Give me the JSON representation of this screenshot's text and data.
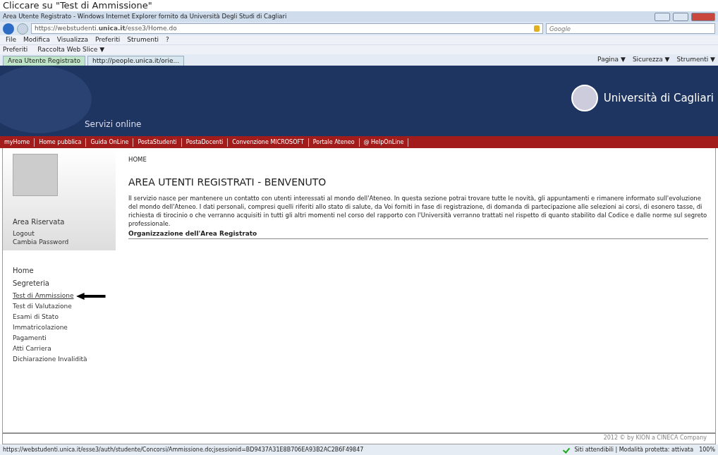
{
  "caption": "Cliccare su \"Test di Ammissione\"",
  "window": {
    "title": "Area Utente Registrato - Windows Internet Explorer fornito da Università Degli Studi di Cagliari"
  },
  "address": {
    "url": "https://webstudenti.**unica.it**/esse3/Home.do",
    "search_placeholder": "Google"
  },
  "menu": [
    "File",
    "Modifica",
    "Visualizza",
    "Preferiti",
    "Strumenti",
    "?"
  ],
  "favorites": [
    "Preferiti",
    "Raccolta Web Slice ▼"
  ],
  "tabs": [
    {
      "label": "Area Utente Registrato",
      "selected": true
    },
    {
      "label": "http://people.unica.it/orie...",
      "selected": false
    }
  ],
  "commands": [
    "Pagina ▼",
    "Sicurezza ▼",
    "Strumenti ▼"
  ],
  "site": {
    "service": "Servizi online",
    "university": "Università di Cagliari",
    "nav": [
      "myHome",
      "Home pubblica",
      "Guida OnLine",
      "PostaStudenti",
      "PostaDocenti",
      "Convenzione MICROSOFT",
      "Portale Ateneo",
      "@ HelpOnLine"
    ],
    "breadcrumb": "HOME",
    "heading": "AREA UTENTI REGISTRATI - BENVENUTO",
    "paragraph": "Il servizio nasce per mantenere un contatto con utenti interessati al mondo dell'Ateneo. In questa sezione potrai trovare tutte le novità, gli appuntamenti e rimanere informato sull'evoluzione del mondo dell'Ateneo. I dati personali, compresi quelli riferiti allo stato di salute, da Voi forniti in fase di registrazione, di domanda di partecipazione alle selezioni ai corsi, di esonero tasse, di richiesta di tirocinio o che verranno acquisiti in tutti gli altri momenti nel corso del rapporto con l'Università verranno trattati nel rispetto di quanto stabilito dal Codice e dalle norme sul segreto professionale.",
    "subheading": "Organizzazione dell'Area Registrato",
    "reserved": {
      "title": "Area Riservata",
      "links": [
        "Logout",
        "Cambia Password"
      ]
    },
    "home": "Home",
    "section": "Segreteria",
    "sidebar_items": [
      {
        "label": "Test di Ammissione",
        "hovered": true
      },
      {
        "label": "Test di Valutazione",
        "hovered": false
      },
      {
        "label": "Esami di Stato",
        "hovered": false
      },
      {
        "label": "Immatricolazione",
        "hovered": false
      },
      {
        "label": "Pagamenti",
        "hovered": false
      },
      {
        "label": "Atti Carriera",
        "hovered": false
      },
      {
        "label": "Dichiarazione Invalidità",
        "hovered": false
      }
    ],
    "footer": "2012 © by KION a CINECA Company"
  },
  "status_bar": {
    "url": "https://webstudenti.unica.it/esse3/auth/studente/Concorsi/Ammissione.do;jsessionid=BD9437A31E8B706EA93B2AC2B6F49847",
    "zone": "Siti attendibili | Modalità protetta: attivata",
    "zoom": "100%"
  }
}
